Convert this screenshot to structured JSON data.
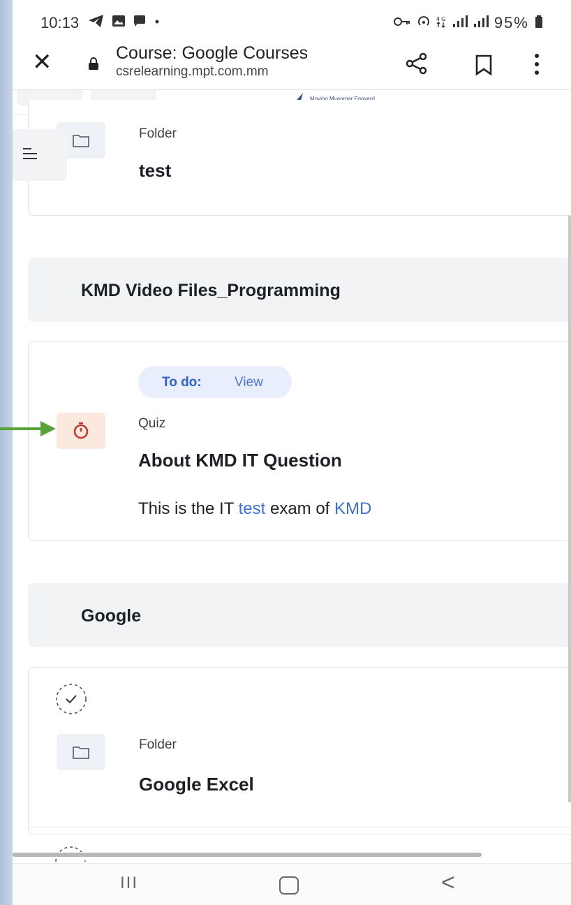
{
  "status_bar": {
    "time": "10:13",
    "left_icons": [
      "telegram-icon",
      "gallery-icon",
      "message-icon",
      "dot-icon"
    ],
    "right_text": "95%",
    "right_icons": [
      "key-icon",
      "hotspot-icon",
      "data-icon",
      "signal-icon",
      "signal-icon",
      "battery-icon"
    ]
  },
  "browser": {
    "title": "Course: Google Courses",
    "url": "csrelearning.mpt.com.mm",
    "close_icon": "close-icon",
    "lock_icon": "lock-icon",
    "share_icon": "share-icon",
    "bookmark_icon": "bookmark-icon",
    "menu_icon": "more-vert-icon"
  },
  "header": {
    "logo_tagline": "Moving Myanmar Forward"
  },
  "activities": [
    {
      "type": "Folder",
      "title": "test",
      "icon": "folder-icon"
    }
  ],
  "sections": [
    {
      "title": "KMD Video Files_Programming",
      "activity": {
        "todo_label": "To do:",
        "todo_value": "View",
        "type": "Quiz",
        "title": "About KMD IT Question",
        "desc_pre": "This is the IT ",
        "desc_link1": "test",
        "desc_mid": " exam of ",
        "desc_link2": "KMD",
        "icon": "quiz-timer-icon"
      }
    },
    {
      "title": "Google",
      "activity": {
        "type": "Folder",
        "title": "Google Excel",
        "icon": "folder-icon",
        "completion_icon": "completion-check-icon"
      }
    }
  ],
  "nav_bar": {
    "recent_label": "III",
    "back_label": "<"
  },
  "colors": {
    "accent_blue": "#3f6fd9",
    "quiz_red": "#c0392b",
    "arrow_green": "#5aa33a"
  }
}
